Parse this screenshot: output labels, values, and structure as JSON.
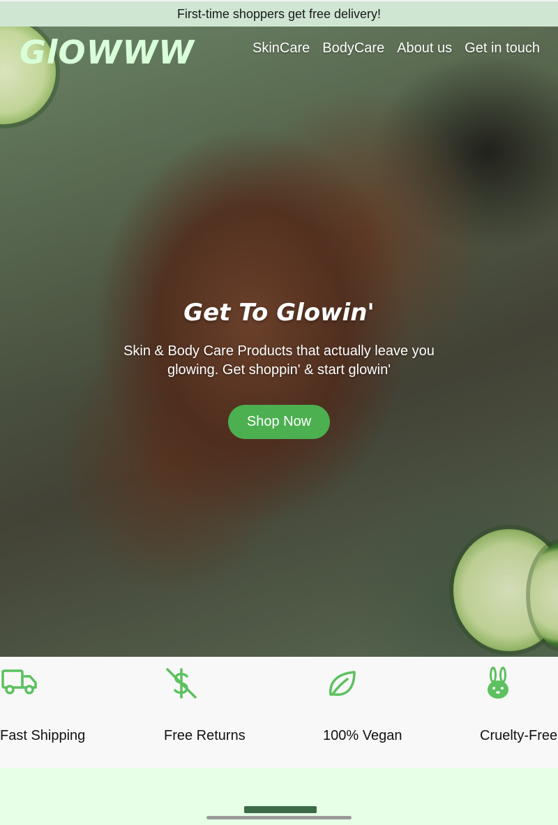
{
  "announcement": "First-time shoppers get free delivery!",
  "brand": "GlOWWW",
  "nav": [
    "SkinCare",
    "BodyCare",
    "About us",
    "Get in touch"
  ],
  "hero": {
    "title": "Get To Glowin'",
    "subtitle": "Skin & Body Care Products that actually leave you glowing. Get shoppin' & start glowin'",
    "cta": "Shop Now"
  },
  "features": [
    {
      "label": "Fast Shipping",
      "icon": "truck-icon"
    },
    {
      "label": "Free Returns",
      "icon": "no-dollar-icon"
    },
    {
      "label": "100% Vegan",
      "icon": "leaf-icon"
    },
    {
      "label": "Cruelty-Free",
      "icon": "bunny-icon"
    }
  ],
  "colors": {
    "accent": "#4caf50",
    "icon_green": "#5cc15f",
    "announcement_bg": "#cfe6d3",
    "brand_text": "#d9ffd9",
    "band_bg": "#e6ffe6"
  }
}
